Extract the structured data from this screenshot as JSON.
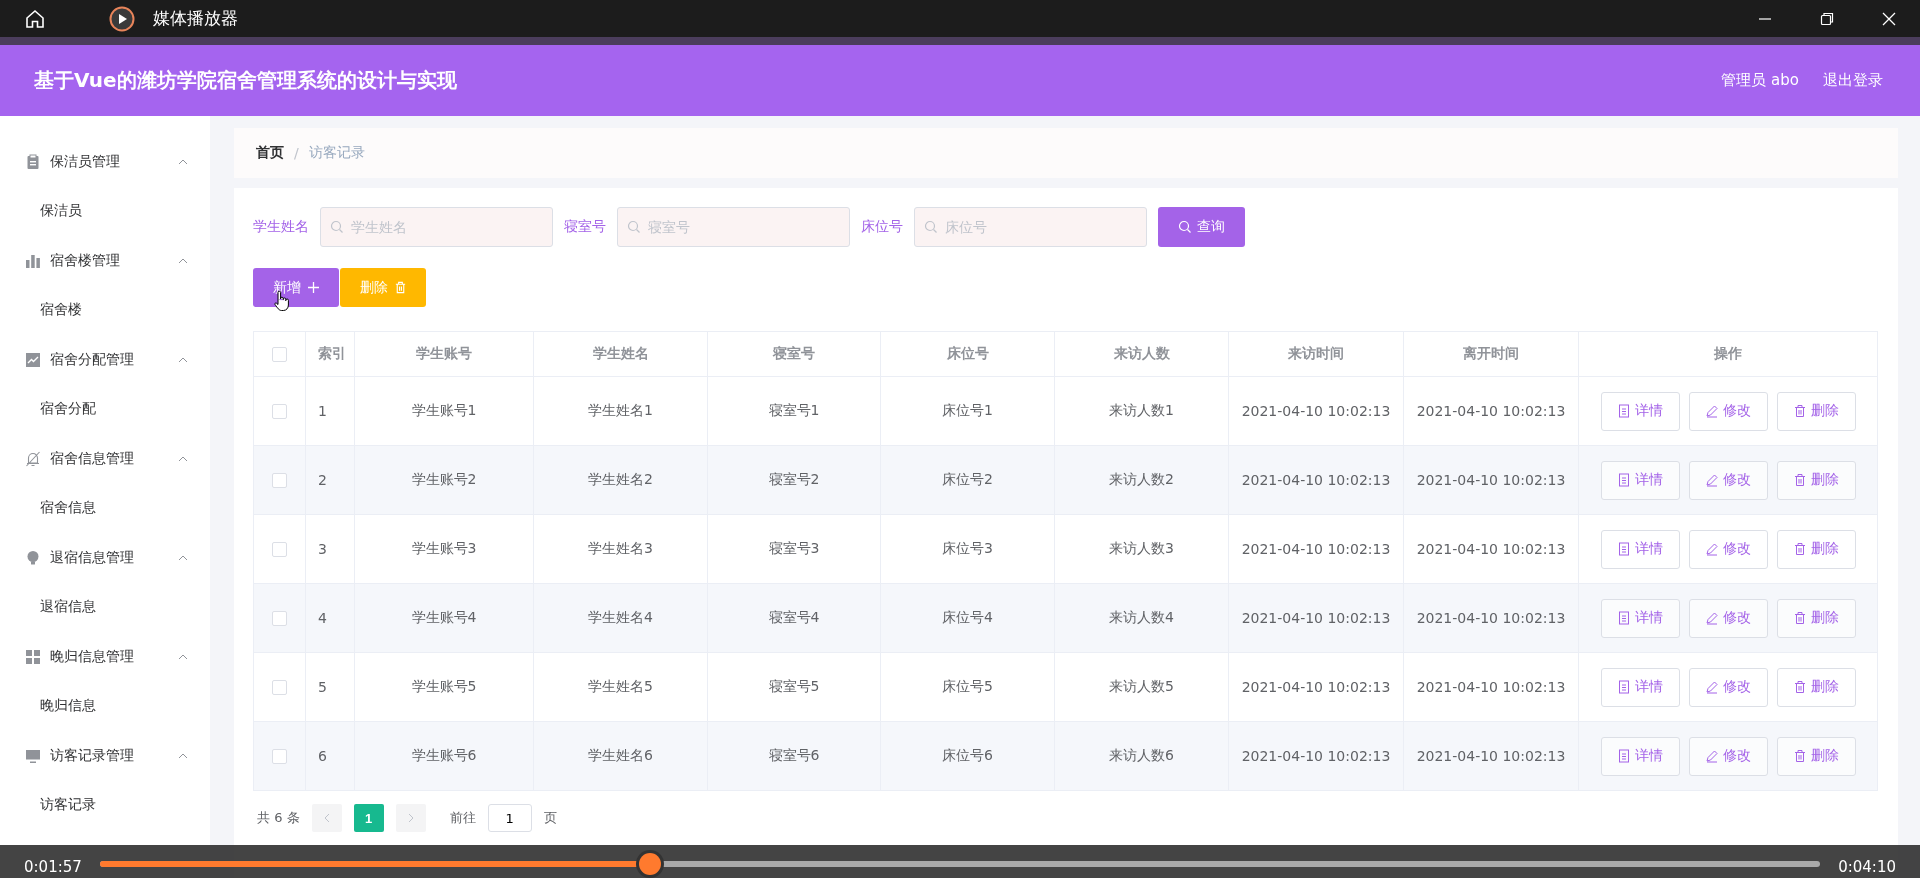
{
  "player": {
    "title": "媒体播放器",
    "elapsed": "0:01:57",
    "duration": "0:04:10",
    "level": 0.32
  },
  "header": {
    "title": "基于Vue的潍坊学院宿舍管理系统的设计与实现",
    "user": "管理员 abo",
    "logout": "退出登录"
  },
  "sidebar": [
    {
      "label": "保洁员管理",
      "kind": "clipboard",
      "expanded": true,
      "children": [
        {
          "label": "保洁员"
        }
      ]
    },
    {
      "label": "宿舍楼管理",
      "kind": "bars",
      "expanded": true,
      "children": [
        {
          "label": "宿舍楼"
        }
      ]
    },
    {
      "label": "宿舍分配管理",
      "kind": "trend",
      "expanded": true,
      "children": [
        {
          "label": "宿舍分配"
        }
      ]
    },
    {
      "label": "宿舍信息管理",
      "kind": "bell",
      "expanded": true,
      "children": [
        {
          "label": "宿舍信息"
        }
      ]
    },
    {
      "label": "退宿信息管理",
      "kind": "bulb",
      "expanded": true,
      "children": [
        {
          "label": "退宿信息"
        }
      ]
    },
    {
      "label": "晚归信息管理",
      "kind": "grid",
      "expanded": true,
      "children": [
        {
          "label": "晚归信息"
        }
      ]
    },
    {
      "label": "访客记录管理",
      "kind": "monitor",
      "expanded": true,
      "children": [
        {
          "label": "访客记录"
        }
      ]
    }
  ],
  "breadcrumb_separator": "/",
  "breadcrumb": [
    {
      "label": "首页",
      "selected": false
    },
    {
      "label": "访客记录",
      "selected": true
    }
  ],
  "search": {
    "fields": [
      {
        "label": "学生姓名",
        "placeholder": "学生姓名"
      },
      {
        "label": "寝室号",
        "placeholder": "寝室号"
      },
      {
        "label": "床位号",
        "placeholder": "床位号"
      }
    ],
    "button": "查询"
  },
  "actions": [
    {
      "label": "新增",
      "kind": "add"
    },
    {
      "label": "删除",
      "kind": "delete"
    }
  ],
  "table": {
    "all_checked": false,
    "columns": [
      "索引",
      "学生账号",
      "学生姓名",
      "寝室号",
      "床位号",
      "来访人数",
      "来访时间",
      "离开时间",
      "操作"
    ],
    "rows": [
      {
        "checked": false,
        "cells": [
          "1",
          "学生账号1",
          "学生姓名1",
          "寝室号1",
          "床位号1",
          "来访人数1",
          "2021-04-10 10:02:13",
          "2021-04-10 10:02:13"
        ],
        "actions": [
          {
            "label": "详情",
            "kind": "detail"
          },
          {
            "label": "修改",
            "kind": "edit"
          },
          {
            "label": "删除",
            "kind": "delete"
          }
        ]
      },
      {
        "checked": false,
        "cells": [
          "2",
          "学生账号2",
          "学生姓名2",
          "寝室号2",
          "床位号2",
          "来访人数2",
          "2021-04-10 10:02:13",
          "2021-04-10 10:02:13"
        ],
        "actions": [
          {
            "label": "详情",
            "kind": "detail"
          },
          {
            "label": "修改",
            "kind": "edit"
          },
          {
            "label": "删除",
            "kind": "delete"
          }
        ]
      },
      {
        "checked": false,
        "cells": [
          "3",
          "学生账号3",
          "学生姓名3",
          "寝室号3",
          "床位号3",
          "来访人数3",
          "2021-04-10 10:02:13",
          "2021-04-10 10:02:13"
        ],
        "actions": [
          {
            "label": "详情",
            "kind": "detail"
          },
          {
            "label": "修改",
            "kind": "edit"
          },
          {
            "label": "删除",
            "kind": "delete"
          }
        ]
      },
      {
        "checked": false,
        "cells": [
          "4",
          "学生账号4",
          "学生姓名4",
          "寝室号4",
          "床位号4",
          "来访人数4",
          "2021-04-10 10:02:13",
          "2021-04-10 10:02:13"
        ],
        "actions": [
          {
            "label": "详情",
            "kind": "detail"
          },
          {
            "label": "修改",
            "kind": "edit"
          },
          {
            "label": "删除",
            "kind": "delete"
          }
        ]
      },
      {
        "checked": false,
        "cells": [
          "5",
          "学生账号5",
          "学生姓名5",
          "寝室号5",
          "床位号5",
          "来访人数5",
          "2021-04-10 10:02:13",
          "2021-04-10 10:02:13"
        ],
        "actions": [
          {
            "label": "详情",
            "kind": "detail"
          },
          {
            "label": "修改",
            "kind": "edit"
          },
          {
            "label": "删除",
            "kind": "delete"
          }
        ]
      },
      {
        "checked": false,
        "cells": [
          "6",
          "学生账号6",
          "学生姓名6",
          "寝室号6",
          "床位号6",
          "来访人数6",
          "2021-04-10 10:02:13",
          "2021-04-10 10:02:13"
        ],
        "actions": [
          {
            "label": "详情",
            "kind": "detail"
          },
          {
            "label": "修改",
            "kind": "edit"
          },
          {
            "label": "删除",
            "kind": "delete"
          }
        ]
      }
    ]
  },
  "pagination": {
    "total": "共 6 条",
    "prev_disabled": true,
    "next_disabled": true,
    "pages": [
      {
        "label": "1",
        "selected": true
      }
    ],
    "goto": "前往",
    "page_value": "1",
    "page_suffix": "页"
  }
}
